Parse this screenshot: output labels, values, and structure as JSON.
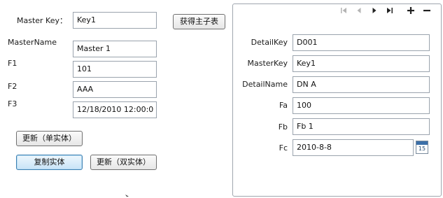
{
  "master": {
    "key_label": "Master Key：",
    "key_value": "Key1",
    "get_button": "获得主子表",
    "name_label": "MasterName",
    "name_value": "Master 1",
    "f1_label": "F1",
    "f1_value": "101",
    "f2_label": "F2",
    "f2_value": "AAA",
    "f3_label": "F3",
    "f3_value": "12/18/2010 12:00:0"
  },
  "buttons": {
    "update_single": "更新（单实体）",
    "copy_entity": "复制实体",
    "update_double": "更新（双实体）"
  },
  "detail": {
    "detail_key_label": "DetailKey",
    "detail_key_value": "D001",
    "master_key_label": "MasterKey",
    "master_key_value": "Key1",
    "detail_name_label": "DetailName",
    "detail_name_value": "DN A",
    "fa_label": "Fa",
    "fa_value": "100",
    "fb_label": "Fb",
    "fb_value": "Fb 1",
    "fc_label": "Fc",
    "fc_value": "2010-8-8",
    "calendar_day": "15"
  },
  "icons": {
    "nav_first": "first-page-icon",
    "nav_prev": "previous-page-icon",
    "nav_next": "next-page-icon",
    "nav_last": "last-page-icon",
    "add": "plus-icon",
    "delete": "minus-icon",
    "calendar": "calendar-icon"
  },
  "colors": {
    "textbox_border": "#9aa3ad",
    "panel_border": "#9fa6ae",
    "focused_button": "#c8e4f7",
    "nav_disabled": "#b4b4b4"
  }
}
